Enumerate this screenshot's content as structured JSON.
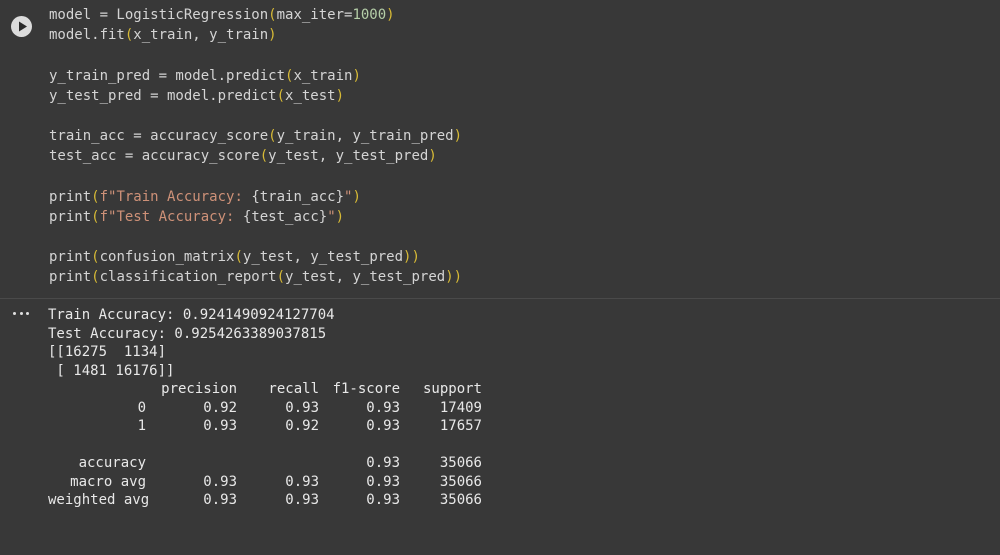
{
  "code": {
    "lines": [
      [
        {
          "t": "name",
          "v": "model = LogisticRegression"
        },
        {
          "t": "paren",
          "v": "("
        },
        {
          "t": "name",
          "v": "max_iter="
        },
        {
          "t": "num",
          "v": "1000"
        },
        {
          "t": "paren",
          "v": ")"
        }
      ],
      [
        {
          "t": "name",
          "v": "model.fit"
        },
        {
          "t": "paren",
          "v": "("
        },
        {
          "t": "name",
          "v": "x_train, y_train"
        },
        {
          "t": "paren",
          "v": ")"
        }
      ],
      [],
      [
        {
          "t": "name",
          "v": "y_train_pred = model.predict"
        },
        {
          "t": "paren",
          "v": "("
        },
        {
          "t": "name",
          "v": "x_train"
        },
        {
          "t": "paren",
          "v": ")"
        }
      ],
      [
        {
          "t": "name",
          "v": "y_test_pred = model.predict"
        },
        {
          "t": "paren",
          "v": "("
        },
        {
          "t": "name",
          "v": "x_test"
        },
        {
          "t": "paren",
          "v": ")"
        }
      ],
      [],
      [
        {
          "t": "name",
          "v": "train_acc = accuracy_score"
        },
        {
          "t": "paren",
          "v": "("
        },
        {
          "t": "name",
          "v": "y_train, y_train_pred"
        },
        {
          "t": "paren",
          "v": ")"
        }
      ],
      [
        {
          "t": "name",
          "v": "test_acc = accuracy_score"
        },
        {
          "t": "paren",
          "v": "("
        },
        {
          "t": "name",
          "v": "y_test, y_test_pred"
        },
        {
          "t": "paren",
          "v": ")"
        }
      ],
      [],
      [
        {
          "t": "name",
          "v": "print"
        },
        {
          "t": "paren",
          "v": "("
        },
        {
          "t": "str",
          "v": "f\"Train Accuracy: "
        },
        {
          "t": "name",
          "v": "{train_acc}"
        },
        {
          "t": "str",
          "v": "\""
        },
        {
          "t": "paren",
          "v": ")"
        }
      ],
      [
        {
          "t": "name",
          "v": "print"
        },
        {
          "t": "paren",
          "v": "("
        },
        {
          "t": "str",
          "v": "f\"Test Accuracy: "
        },
        {
          "t": "name",
          "v": "{test_acc}"
        },
        {
          "t": "str",
          "v": "\""
        },
        {
          "t": "paren",
          "v": ")"
        }
      ],
      [],
      [
        {
          "t": "name",
          "v": "print"
        },
        {
          "t": "paren",
          "v": "("
        },
        {
          "t": "name",
          "v": "confusion_matrix"
        },
        {
          "t": "paren",
          "v": "("
        },
        {
          "t": "name",
          "v": "y_test, y_test_pred"
        },
        {
          "t": "paren",
          "v": "))"
        }
      ],
      [
        {
          "t": "name",
          "v": "print"
        },
        {
          "t": "paren",
          "v": "("
        },
        {
          "t": "name",
          "v": "classification_report"
        },
        {
          "t": "paren",
          "v": "("
        },
        {
          "t": "name",
          "v": "y_test, y_test_pred"
        },
        {
          "t": "paren",
          "v": "))"
        }
      ]
    ]
  },
  "output": {
    "lines": [
      "Train Accuracy: 0.9241490924127704",
      "Test Accuracy: 0.9254263389037815",
      "[[16275  1134]",
      " [ 1481 16176]]"
    ],
    "report": {
      "headers": [
        "",
        "precision",
        "recall",
        "f1-score",
        "support"
      ],
      "rows": [
        [
          "0",
          "0.92",
          "0.93",
          "0.93",
          "17409"
        ],
        [
          "1",
          "0.93",
          "0.92",
          "0.93",
          "17657"
        ],
        [
          "",
          "",
          "",
          "",
          ""
        ],
        [
          "accuracy",
          "",
          "",
          "0.93",
          "35066"
        ],
        [
          "macro avg",
          "0.93",
          "0.93",
          "0.93",
          "35066"
        ],
        [
          "weighted avg",
          "0.93",
          "0.93",
          "0.93",
          "35066"
        ]
      ]
    }
  },
  "icons": {
    "run": "play-circle-icon",
    "output_menu": "more-horizontal-icon"
  },
  "colors": {
    "background": "#383838",
    "text": "#d4d4d4",
    "paren": "#d7ba36",
    "number": "#b5cea8",
    "string": "#ce9178"
  }
}
